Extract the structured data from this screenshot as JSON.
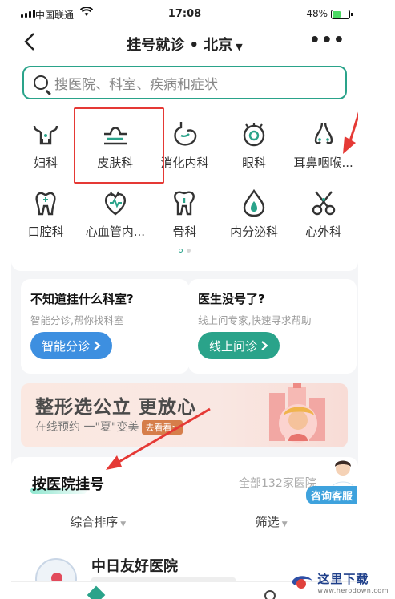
{
  "status_bar": {
    "carrier": "中国联通",
    "time": "17:08",
    "battery": "48%"
  },
  "nav": {
    "title": "挂号就诊 • 北京",
    "more": "•••"
  },
  "search": {
    "placeholder": "搜医院、科室、疾病和症状"
  },
  "departments": [
    {
      "label": "妇科",
      "icon": "uterus-icon"
    },
    {
      "label": "皮肤科",
      "icon": "skin-icon"
    },
    {
      "label": "消化内科",
      "icon": "stomach-icon"
    },
    {
      "label": "眼科",
      "icon": "eye-icon"
    },
    {
      "label": "耳鼻咽喉...",
      "icon": "nose-icon"
    },
    {
      "label": "口腔科",
      "icon": "tooth-icon"
    },
    {
      "label": "心血管内...",
      "icon": "heart-icon"
    },
    {
      "label": "骨科",
      "icon": "bone-icon"
    },
    {
      "label": "内分泌科",
      "icon": "drop-icon"
    },
    {
      "label": "心外科",
      "icon": "scissors-icon"
    }
  ],
  "help_cards": [
    {
      "title": "不知道挂什么科室?",
      "subtitle": "智能分诊,帮你找科室",
      "button": "智能分诊",
      "color": "#3d8fe0"
    },
    {
      "title": "医生没号了?",
      "subtitle": "线上问专家,快速寻求帮助",
      "button": "线上问诊",
      "color": "#2aa38a"
    }
  ],
  "banner": {
    "headline": "整形选公立 更放心",
    "subline": "在线预约 一\"夏\"变美",
    "tag": "去看看>"
  },
  "hospital_section": {
    "title": "按医院挂号",
    "all_count": "全部132家医院",
    "service": "咨询客服",
    "sort_label": "综合排序",
    "filter_label": "筛选",
    "first_hospital": "中日友好医院"
  },
  "watermark": {
    "text": "这里下载",
    "url": "www.herodown.com"
  },
  "colors": {
    "accent": "#2aa38a",
    "highlight": "#e53935"
  }
}
